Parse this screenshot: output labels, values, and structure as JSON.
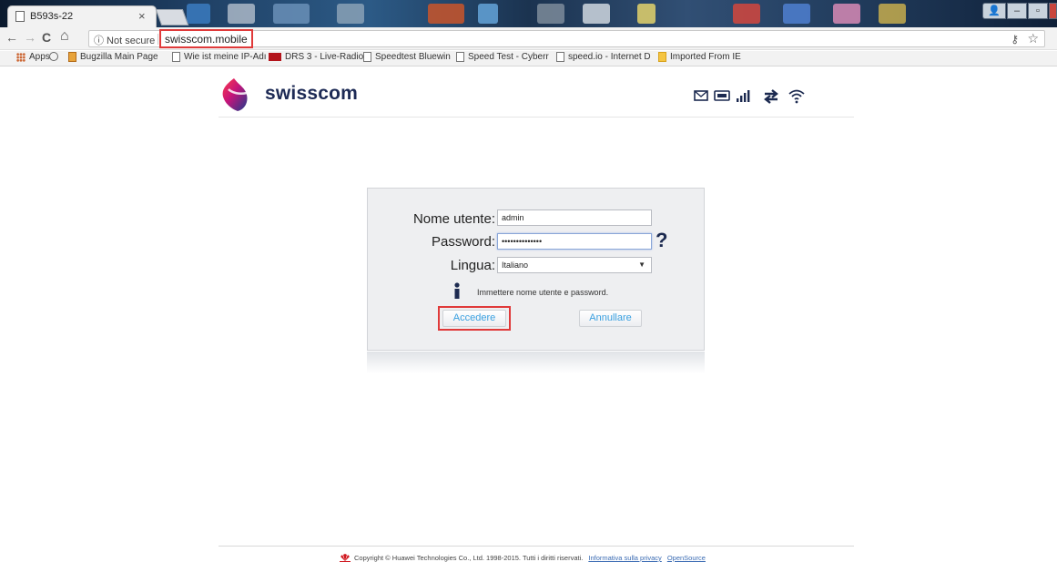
{
  "browser": {
    "tab_title": "B593s-22",
    "tab_close": "×",
    "secure_label": "ⓘ Not secure",
    "url": "swisscom.mobile",
    "bookmarks": [
      {
        "label": "Apps",
        "icon": "apps-grid-icon"
      },
      {
        "label": "",
        "icon": "history-icon"
      },
      {
        "label": "Bugzilla Main Page",
        "icon": "bugzilla-icon"
      },
      {
        "label": "Wie ist meine IP-Adı",
        "icon": "page-icon"
      },
      {
        "label": "DRS 3 - Live-Radio",
        "icon": "srf-icon"
      },
      {
        "label": "Speedtest Bluewin",
        "icon": "page-icon"
      },
      {
        "label": "Speed Test - Cyberr",
        "icon": "page-icon"
      },
      {
        "label": "speed.io - Internet D",
        "icon": "page-icon"
      },
      {
        "label": "Imported From IE",
        "icon": "folder-icon"
      }
    ],
    "nav": {
      "back": "←",
      "forward": "→",
      "reload": "C",
      "home": "⌂"
    }
  },
  "header": {
    "brand": "swisscom",
    "status_icons": [
      "mail-icon",
      "usb-icon",
      "signal-icon",
      "data-transfer-icon",
      "wifi-icon"
    ]
  },
  "login": {
    "username_label": "Nome utente:",
    "username_value": "admin",
    "password_label": "Password:",
    "password_value": "••••••••••••••",
    "help": "?",
    "language_label": "Lingua:",
    "language_value": "Italiano",
    "info_text": "Immettere nome utente e password.",
    "login_button": "Accedere",
    "cancel_button": "Annullare"
  },
  "footer": {
    "copyright": "Copyright © Huawei Technologies Co., Ltd. 1998-2015. Tutti i diritti riservati.",
    "privacy_link": "Informativa sulla privacy",
    "opensource_link": "OpenSource"
  },
  "colors": {
    "highlight_red": "#e03a3a",
    "button_text_blue": "#3aa0e0",
    "brand_navy": "#1d2a55"
  }
}
